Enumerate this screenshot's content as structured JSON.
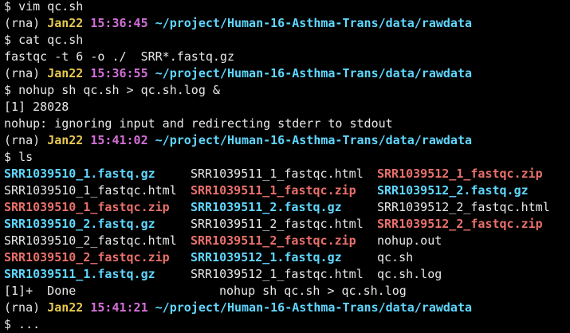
{
  "terminal": {
    "prompt_symbol": "$",
    "env": "(rna)",
    "date": "Jan22",
    "path": "~/project/Human-16-Asthma-Trans/data/rawdata",
    "lines": {
      "cmd1": "vim qc.sh",
      "time1": "15:36:45",
      "cmd2": "cat qc.sh",
      "output1": "fastqc -t 6 -o ./  SRR*.fastq.gz",
      "time2": "15:36:55",
      "cmd3": "nohup sh qc.sh > qc.sh.log &",
      "output2": "[1] 28028",
      "output3": "nohup: ignoring input and redirecting stderr to stdout",
      "time3": "15:41:02",
      "cmd4": "ls",
      "job_status": "[1]+  Done",
      "job_cmd": "nohup sh qc.sh > qc.sh.log",
      "time4": "15:41:21",
      "cursor_line": "$ ..."
    },
    "files": [
      {
        "name": "SRR1039510_1.fastq.gz",
        "type": "gz"
      },
      {
        "name": "SRR1039511_1_fastqc.html",
        "type": "html"
      },
      {
        "name": "SRR1039512_1_fastqc.zip",
        "type": "zip"
      },
      {
        "name": "SRR1039510_1_fastqc.html",
        "type": "html"
      },
      {
        "name": "SRR1039511_1_fastqc.zip",
        "type": "zip"
      },
      {
        "name": "SRR1039512_2.fastq.gz",
        "type": "gz"
      },
      {
        "name": "SRR1039510_1_fastqc.zip",
        "type": "zip"
      },
      {
        "name": "SRR1039511_2.fastq.gz",
        "type": "gz"
      },
      {
        "name": "SRR1039512_2_fastqc.html",
        "type": "html"
      },
      {
        "name": "SRR1039510_2.fastq.gz",
        "type": "gz"
      },
      {
        "name": "SRR1039511_2_fastqc.html",
        "type": "html"
      },
      {
        "name": "SRR1039512_2_fastqc.zip",
        "type": "zip"
      },
      {
        "name": "SRR1039510_2_fastqc.html",
        "type": "html"
      },
      {
        "name": "SRR1039511_2_fastqc.zip",
        "type": "zip"
      },
      {
        "name": "nohup.out",
        "type": "other"
      },
      {
        "name": "SRR1039510_2_fastqc.zip",
        "type": "zip"
      },
      {
        "name": "SRR1039512_1.fastq.gz",
        "type": "gz"
      },
      {
        "name": "qc.sh",
        "type": "other"
      },
      {
        "name": "SRR1039511_1.fastq.gz",
        "type": "gz"
      },
      {
        "name": "SRR1039512_1_fastqc.html",
        "type": "html"
      },
      {
        "name": "qc.sh.log",
        "type": "other"
      }
    ],
    "colors": {
      "background": "#000000",
      "text": "#e8e8e8",
      "date": "#e6c84f",
      "time": "#d36fd8",
      "path": "#5fd7ff",
      "gz_file": "#5fd7ff",
      "zip_file": "#e9706a"
    }
  }
}
